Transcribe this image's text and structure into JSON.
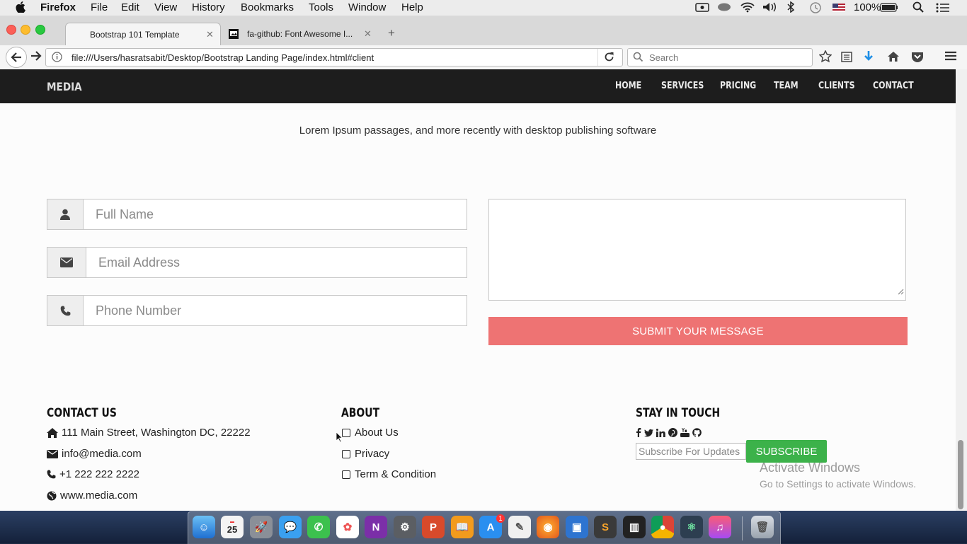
{
  "menubar": {
    "app": "Firefox",
    "items": [
      "File",
      "Edit",
      "View",
      "History",
      "Bookmarks",
      "Tools",
      "Window",
      "Help"
    ],
    "battery": "100%"
  },
  "browser": {
    "tabs": [
      {
        "title": "Bootstrap 101 Template"
      },
      {
        "title": "fa-github: Font Awesome I..."
      }
    ],
    "url": "file:///Users/hasratsabit/Desktop/Bootstrap Landing Page/index.html#client",
    "search_placeholder": "Search"
  },
  "site": {
    "brand": "MEDIA",
    "nav": [
      "HOME",
      "SERVICES",
      "PRICING",
      "TEAM",
      "CLIENTS",
      "CONTACT"
    ],
    "lead": "Lorem Ipsum passages, and more recently with desktop publishing software",
    "form": {
      "name_placeholder": "Full Name",
      "email_placeholder": "Email Address",
      "phone_placeholder": "Phone Number",
      "submit": "SUBMIT YOUR MESSAGE"
    },
    "footer": {
      "contact_heading": "CONTACT US",
      "address": "111 Main Street, Washington DC, 22222",
      "email": "info@media.com",
      "phone": "+1 222 222 2222",
      "website": "www.media.com",
      "about_heading": "ABOUT",
      "about_links": [
        "About Us",
        "Privacy",
        "Term & Condition"
      ],
      "stay_heading": "STAY IN TOUCH",
      "subscribe_placeholder": "Subscribe For Updates",
      "subscribe_button": "SUBSCRIBE"
    }
  },
  "watermark": {
    "line1": "Activate Windows",
    "line2": "Go to Settings to activate Windows."
  },
  "dock": {
    "calendar_day": "25",
    "badge": "1"
  },
  "colors": {
    "navbar": "#1d1d1d",
    "submit": "#ee7373",
    "subscribe": "#3cb24a"
  }
}
